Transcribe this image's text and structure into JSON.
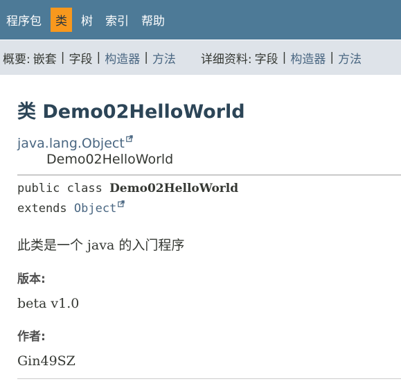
{
  "topnav": {
    "items": [
      {
        "label": "程序包",
        "active": false
      },
      {
        "label": "类",
        "active": true
      },
      {
        "label": "树",
        "active": false
      },
      {
        "label": "索引",
        "active": false
      },
      {
        "label": "帮助",
        "active": false
      }
    ],
    "colors": {
      "bar": "#4d7a97",
      "active_bg": "#f8981d"
    }
  },
  "subnav": {
    "summary_label": "概要:",
    "summary_items": [
      "嵌套",
      "字段",
      "构造器",
      "方法"
    ],
    "detail_label": "详细资料:",
    "detail_items": [
      "字段",
      "构造器",
      "方法"
    ],
    "separator": "|"
  },
  "class_info": {
    "title": "类 Demo02HelloWorld",
    "parent": "java.lang.Object",
    "child": "Demo02HelloWorld",
    "signature_line1_prefix": "public class ",
    "signature_class": "Demo02HelloWorld",
    "signature_line2_prefix": "extends ",
    "signature_extends": "Object",
    "description": "此类是一个 java 的入门程序",
    "version_label": "版本:",
    "version_value": "beta v1.0",
    "author_label": "作者:",
    "author_value": "Gin49SZ"
  },
  "icons": {
    "external_link": "external-link-icon"
  }
}
